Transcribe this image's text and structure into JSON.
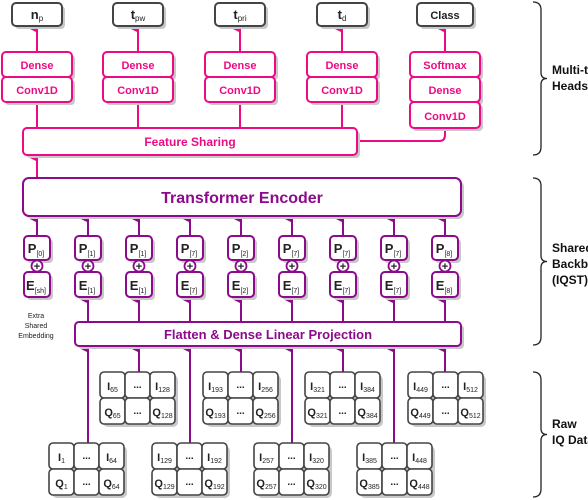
{
  "colors": {
    "pink": "#ee0a84",
    "purple": "#8c0a8c",
    "gray": "#444444",
    "shadow": "#c8c8c8"
  },
  "heads": {
    "outputs": [
      {
        "main": "n",
        "sub": "p"
      },
      {
        "main": "t",
        "sub": "pw"
      },
      {
        "main": "t",
        "sub": "pri"
      },
      {
        "main": "t",
        "sub": "d"
      },
      {
        "main": "Class",
        "sub": ""
      }
    ],
    "dense_label": "Dense",
    "conv_label": "Conv1D",
    "softmax_label": "Softmax",
    "feature_sharing_label": "Feature Sharing"
  },
  "backbone": {
    "encoder_label": "Transformer Encoder",
    "plus_symbol": "+",
    "tokens": [
      {
        "p": "[0]",
        "e": "[sh]"
      },
      {
        "p": "[1]",
        "e": "[1]"
      },
      {
        "p": "[1]",
        "e": "[1]"
      },
      {
        "p": "[7]",
        "e": "[7]"
      },
      {
        "p": "[2]",
        "e": "[2]"
      },
      {
        "p": "[7]",
        "e": "[7]"
      },
      {
        "p": "[7]",
        "e": "[7]"
      },
      {
        "p": "[7]",
        "e": "[7]"
      },
      {
        "p": "[8]",
        "e": "[8]"
      }
    ],
    "extra_label": [
      "Extra",
      "Shared",
      "Embedding"
    ],
    "projection_label": "Flatten & Dense Linear Projection"
  },
  "raw_iq": {
    "ellipsis": "...",
    "blocks": [
      {
        "i_start": "1",
        "i_end": "64",
        "q_start": "1",
        "q_end": "64"
      },
      {
        "i_start": "65",
        "i_end": "128",
        "q_start": "65",
        "q_end": "128"
      },
      {
        "i_start": "129",
        "i_end": "192",
        "q_start": "129",
        "q_end": "192"
      },
      {
        "i_start": "193",
        "i_end": "256",
        "q_start": "193",
        "q_end": "256"
      },
      {
        "i_start": "257",
        "i_end": "320",
        "q_start": "257",
        "q_end": "320"
      },
      {
        "i_start": "321",
        "i_end": "384",
        "q_start": "321",
        "q_end": "384"
      },
      {
        "i_start": "385",
        "i_end": "448",
        "q_start": "385",
        "q_end": "448"
      },
      {
        "i_start": "449",
        "i_end": "512",
        "q_start": "449",
        "q_end": "512"
      }
    ]
  },
  "sections": [
    {
      "lines": [
        "Multi-task",
        "Heads"
      ]
    },
    {
      "lines": [
        "Shared",
        "Backbone",
        "(IQST)"
      ]
    },
    {
      "lines": [
        "Raw",
        "IQ Data"
      ]
    }
  ]
}
